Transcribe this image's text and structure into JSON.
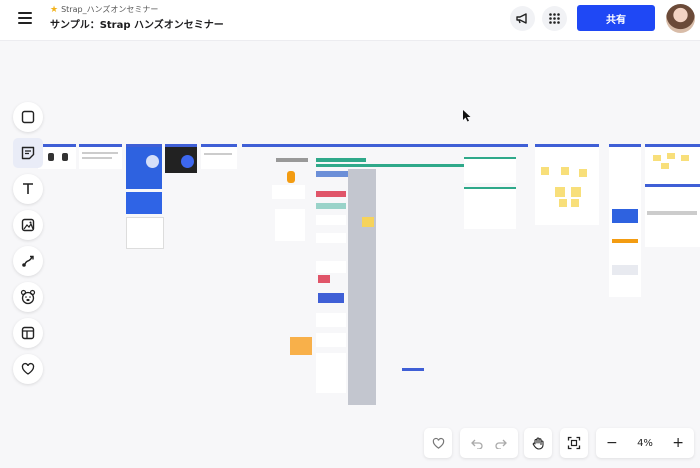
{
  "header": {
    "breadcrumb": "Strap_ハンズオンセミナー",
    "title": "サンプル：Strap ハンズオンセミナー",
    "share_label": "共有"
  },
  "icons": {
    "menu": "hamburger-menu-icon",
    "announce": "megaphone-icon",
    "apps": "grid-dots-icon",
    "favorite_star": "star-icon"
  },
  "toolbar": {
    "items": [
      {
        "name": "shape-tool",
        "icon": "square-icon"
      },
      {
        "name": "sticky-note-tool",
        "icon": "sticky-note-icon",
        "active": true
      },
      {
        "name": "text-tool",
        "icon": "text-icon"
      },
      {
        "name": "image-tool",
        "icon": "image-icon"
      },
      {
        "name": "connector-tool",
        "icon": "connector-icon"
      },
      {
        "name": "stamp-tool",
        "icon": "bear-icon"
      },
      {
        "name": "template-tool",
        "icon": "template-icon"
      },
      {
        "name": "reaction-tool",
        "icon": "heart-icon"
      }
    ]
  },
  "bottom": {
    "zoom_value": "4%",
    "zoom_out": "−",
    "zoom_in": "+"
  },
  "colors": {
    "accent": "#1f48f5",
    "frame_header": "#3f5fd6",
    "sticky_yellow": "#f8df7a",
    "board_bg": "#f7f7f9"
  }
}
